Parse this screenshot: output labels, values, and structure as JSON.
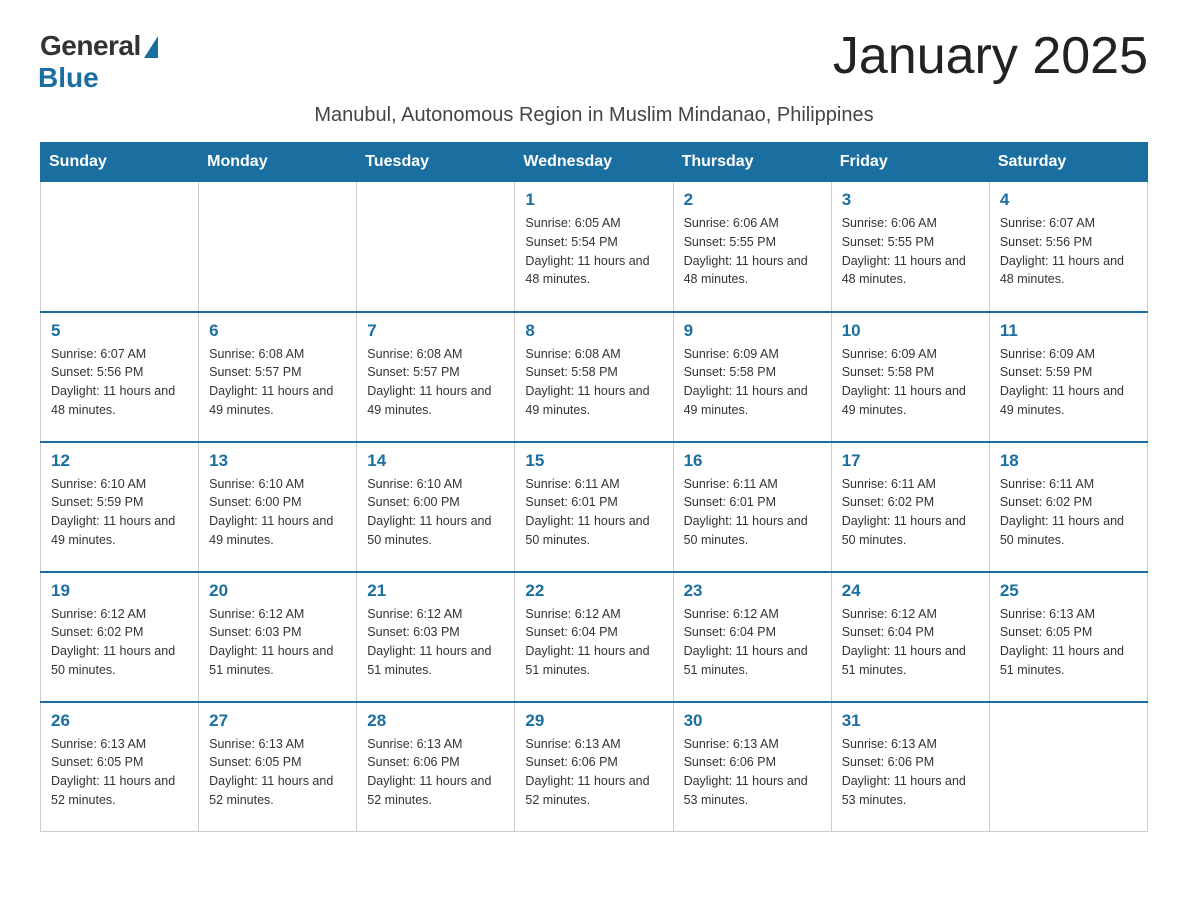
{
  "logo": {
    "general": "General",
    "blue": "Blue"
  },
  "title": "January 2025",
  "subtitle": "Manubul, Autonomous Region in Muslim Mindanao, Philippines",
  "weekdays": [
    "Sunday",
    "Monday",
    "Tuesday",
    "Wednesday",
    "Thursday",
    "Friday",
    "Saturday"
  ],
  "weeks": [
    [
      {
        "day": "",
        "info": ""
      },
      {
        "day": "",
        "info": ""
      },
      {
        "day": "",
        "info": ""
      },
      {
        "day": "1",
        "info": "Sunrise: 6:05 AM\nSunset: 5:54 PM\nDaylight: 11 hours and 48 minutes."
      },
      {
        "day": "2",
        "info": "Sunrise: 6:06 AM\nSunset: 5:55 PM\nDaylight: 11 hours and 48 minutes."
      },
      {
        "day": "3",
        "info": "Sunrise: 6:06 AM\nSunset: 5:55 PM\nDaylight: 11 hours and 48 minutes."
      },
      {
        "day": "4",
        "info": "Sunrise: 6:07 AM\nSunset: 5:56 PM\nDaylight: 11 hours and 48 minutes."
      }
    ],
    [
      {
        "day": "5",
        "info": "Sunrise: 6:07 AM\nSunset: 5:56 PM\nDaylight: 11 hours and 48 minutes."
      },
      {
        "day": "6",
        "info": "Sunrise: 6:08 AM\nSunset: 5:57 PM\nDaylight: 11 hours and 49 minutes."
      },
      {
        "day": "7",
        "info": "Sunrise: 6:08 AM\nSunset: 5:57 PM\nDaylight: 11 hours and 49 minutes."
      },
      {
        "day": "8",
        "info": "Sunrise: 6:08 AM\nSunset: 5:58 PM\nDaylight: 11 hours and 49 minutes."
      },
      {
        "day": "9",
        "info": "Sunrise: 6:09 AM\nSunset: 5:58 PM\nDaylight: 11 hours and 49 minutes."
      },
      {
        "day": "10",
        "info": "Sunrise: 6:09 AM\nSunset: 5:58 PM\nDaylight: 11 hours and 49 minutes."
      },
      {
        "day": "11",
        "info": "Sunrise: 6:09 AM\nSunset: 5:59 PM\nDaylight: 11 hours and 49 minutes."
      }
    ],
    [
      {
        "day": "12",
        "info": "Sunrise: 6:10 AM\nSunset: 5:59 PM\nDaylight: 11 hours and 49 minutes."
      },
      {
        "day": "13",
        "info": "Sunrise: 6:10 AM\nSunset: 6:00 PM\nDaylight: 11 hours and 49 minutes."
      },
      {
        "day": "14",
        "info": "Sunrise: 6:10 AM\nSunset: 6:00 PM\nDaylight: 11 hours and 50 minutes."
      },
      {
        "day": "15",
        "info": "Sunrise: 6:11 AM\nSunset: 6:01 PM\nDaylight: 11 hours and 50 minutes."
      },
      {
        "day": "16",
        "info": "Sunrise: 6:11 AM\nSunset: 6:01 PM\nDaylight: 11 hours and 50 minutes."
      },
      {
        "day": "17",
        "info": "Sunrise: 6:11 AM\nSunset: 6:02 PM\nDaylight: 11 hours and 50 minutes."
      },
      {
        "day": "18",
        "info": "Sunrise: 6:11 AM\nSunset: 6:02 PM\nDaylight: 11 hours and 50 minutes."
      }
    ],
    [
      {
        "day": "19",
        "info": "Sunrise: 6:12 AM\nSunset: 6:02 PM\nDaylight: 11 hours and 50 minutes."
      },
      {
        "day": "20",
        "info": "Sunrise: 6:12 AM\nSunset: 6:03 PM\nDaylight: 11 hours and 51 minutes."
      },
      {
        "day": "21",
        "info": "Sunrise: 6:12 AM\nSunset: 6:03 PM\nDaylight: 11 hours and 51 minutes."
      },
      {
        "day": "22",
        "info": "Sunrise: 6:12 AM\nSunset: 6:04 PM\nDaylight: 11 hours and 51 minutes."
      },
      {
        "day": "23",
        "info": "Sunrise: 6:12 AM\nSunset: 6:04 PM\nDaylight: 11 hours and 51 minutes."
      },
      {
        "day": "24",
        "info": "Sunrise: 6:12 AM\nSunset: 6:04 PM\nDaylight: 11 hours and 51 minutes."
      },
      {
        "day": "25",
        "info": "Sunrise: 6:13 AM\nSunset: 6:05 PM\nDaylight: 11 hours and 51 minutes."
      }
    ],
    [
      {
        "day": "26",
        "info": "Sunrise: 6:13 AM\nSunset: 6:05 PM\nDaylight: 11 hours and 52 minutes."
      },
      {
        "day": "27",
        "info": "Sunrise: 6:13 AM\nSunset: 6:05 PM\nDaylight: 11 hours and 52 minutes."
      },
      {
        "day": "28",
        "info": "Sunrise: 6:13 AM\nSunset: 6:06 PM\nDaylight: 11 hours and 52 minutes."
      },
      {
        "day": "29",
        "info": "Sunrise: 6:13 AM\nSunset: 6:06 PM\nDaylight: 11 hours and 52 minutes."
      },
      {
        "day": "30",
        "info": "Sunrise: 6:13 AM\nSunset: 6:06 PM\nDaylight: 11 hours and 53 minutes."
      },
      {
        "day": "31",
        "info": "Sunrise: 6:13 AM\nSunset: 6:06 PM\nDaylight: 11 hours and 53 minutes."
      },
      {
        "day": "",
        "info": ""
      }
    ]
  ]
}
